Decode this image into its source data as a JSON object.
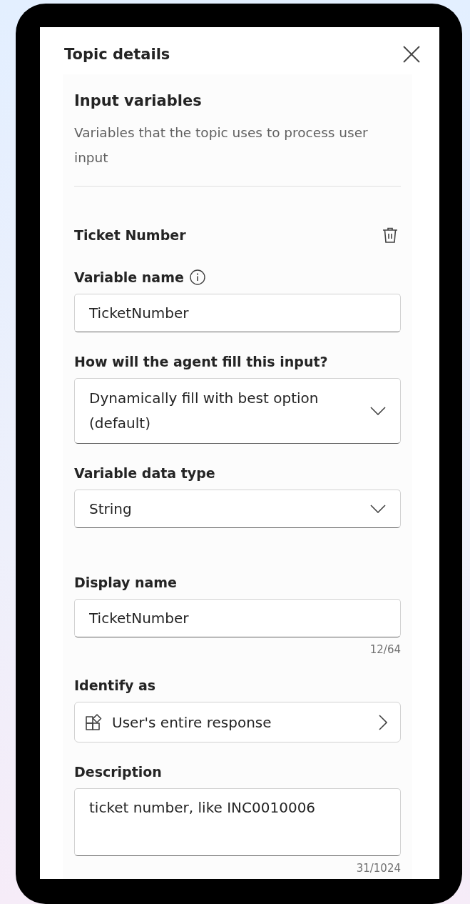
{
  "panel": {
    "title": "Topic details"
  },
  "section": {
    "title": "Input variables",
    "description": "Variables that the topic uses to process user input"
  },
  "variable": {
    "name": "Ticket Number",
    "fields": [
      {
        "kind": "text",
        "label": "Variable name",
        "info": true,
        "value": "TicketNumber"
      },
      {
        "kind": "dropdown",
        "label": "How will the agent fill this input?",
        "info": false,
        "value": "Dynamically fill with best option (default)"
      },
      {
        "kind": "dropdown",
        "label": "Variable data type",
        "info": false,
        "value": "String"
      },
      {
        "kind": "text",
        "label": "Display name",
        "info": false,
        "value": "TicketNumber",
        "counter": "12/64"
      },
      {
        "kind": "entity",
        "label": "Identify as",
        "info": false,
        "value": "User's entire response"
      },
      {
        "kind": "textarea",
        "label": "Description",
        "info": false,
        "value": "ticket number, like INC0010006",
        "counter": "31/1024"
      }
    ]
  }
}
